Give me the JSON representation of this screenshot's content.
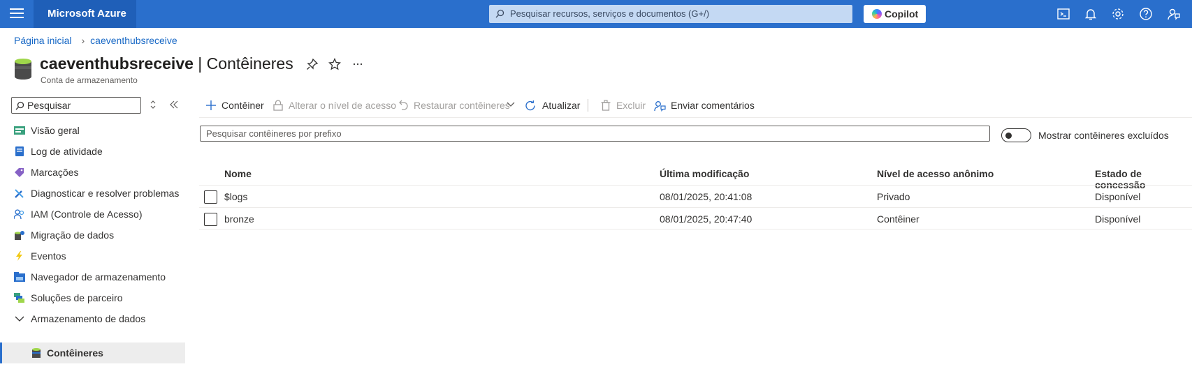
{
  "topbar": {
    "brand": "Microsoft Azure",
    "search_placeholder": "Pesquisar recursos, serviços e documentos (G+/)",
    "copilot_label": "Copilot",
    "icons": [
      "cloud-shell-icon",
      "bell-icon",
      "gear-icon",
      "help-icon",
      "feedback-icon"
    ]
  },
  "breadcrumb": {
    "home": "Página inicial",
    "current": "caeventhubsreceive"
  },
  "header": {
    "resource_name": "caeventhubsreceive",
    "separator": " | ",
    "page_name": "Contêineres",
    "subtitle": "Conta de armazenamento"
  },
  "sidebar": {
    "search_placeholder": "Pesquisar",
    "items": [
      {
        "label": "Visão geral",
        "icon": "overview-icon"
      },
      {
        "label": "Log de atividade",
        "icon": "activity-log-icon"
      },
      {
        "label": "Marcações",
        "icon": "tag-icon"
      },
      {
        "label": "Diagnosticar e resolver problemas",
        "icon": "wrench-icon"
      },
      {
        "label": "IAM (Controle de Acesso)",
        "icon": "people-icon"
      },
      {
        "label": "Migração de dados",
        "icon": "migration-icon"
      },
      {
        "label": "Eventos",
        "icon": "lightning-icon"
      },
      {
        "label": "Navegador de armazenamento",
        "icon": "storage-browser-icon"
      },
      {
        "label": "Soluções de parceiro",
        "icon": "partner-icon"
      },
      {
        "label": "Armazenamento de dados",
        "icon": "chevron-down-icon"
      },
      {
        "label": "Contêineres",
        "icon": "container-icon"
      }
    ]
  },
  "commands": {
    "add": "Contêiner",
    "change_access": "Alterar o nível de acesso",
    "restore": "Restaurar contêineres",
    "refresh": "Atualizar",
    "delete": "Excluir",
    "feedback": "Enviar comentários"
  },
  "filter": {
    "placeholder": "Pesquisar contêineres por prefixo",
    "toggle_label": "Mostrar contêineres excluídos"
  },
  "table": {
    "columns": [
      "Nome",
      "Última modificação",
      "Nível de acesso anônimo",
      "Estado de concessão"
    ],
    "rows": [
      {
        "name": "$logs",
        "modified": "08/01/2025, 20:41:08",
        "access": "Privado",
        "lease": "Disponível"
      },
      {
        "name": "bronze",
        "modified": "08/01/2025, 20:47:40",
        "access": "Contêiner",
        "lease": "Disponível"
      }
    ]
  },
  "colors": {
    "topbar": "#2a6fcc",
    "link": "#1667c5"
  }
}
